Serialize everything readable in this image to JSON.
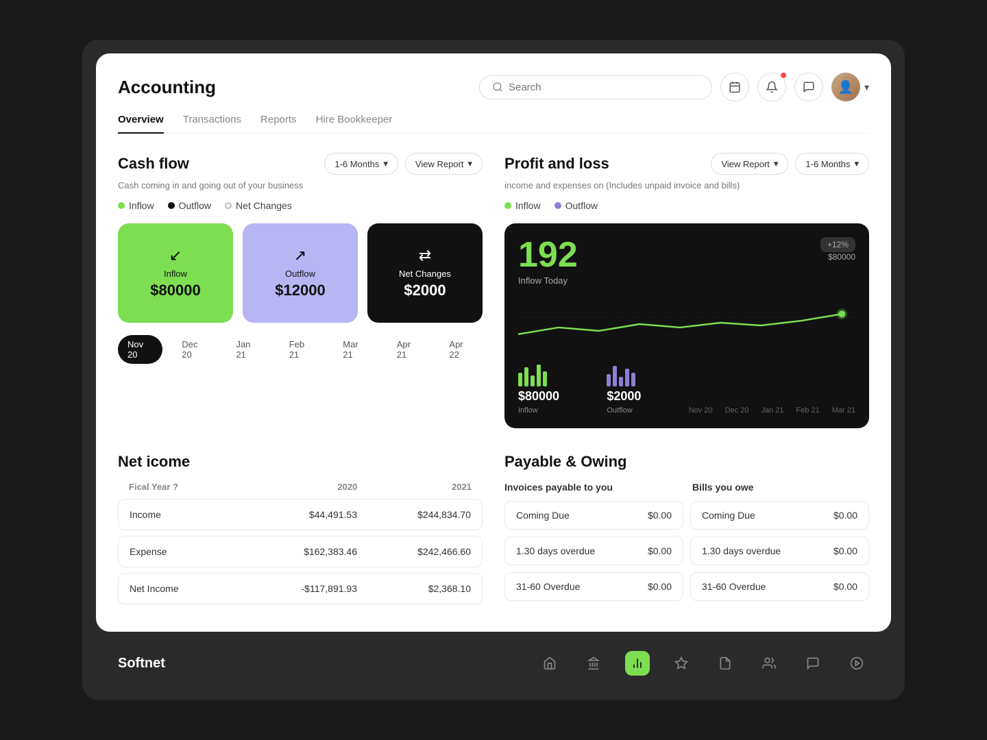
{
  "app": {
    "title": "Accounting",
    "brand": "Softnet"
  },
  "header": {
    "search_placeholder": "Search",
    "nav_tabs": [
      {
        "label": "Overview",
        "active": true
      },
      {
        "label": "Transactions",
        "active": false
      },
      {
        "label": "Reports",
        "active": false
      },
      {
        "label": "Hire Bookkeeper",
        "active": false
      }
    ]
  },
  "cashflow": {
    "title": "Cash flow",
    "subtitle": "Cash coming in and going out of your business",
    "period_label": "1-6 Months",
    "view_report_label": "View Report",
    "legend": [
      {
        "label": "Inflow",
        "type": "filled",
        "color": "#7dde52"
      },
      {
        "label": "Outflow",
        "type": "filled",
        "color": "#333"
      },
      {
        "label": "Net Changes",
        "type": "outline"
      }
    ],
    "cards": [
      {
        "label": "Inflow",
        "value": "$80000",
        "icon": "↙",
        "type": "inflow"
      },
      {
        "label": "Outflow",
        "value": "$12000",
        "icon": "↗",
        "type": "outflow"
      },
      {
        "label": "Net Changes",
        "value": "$2000",
        "icon": "→←",
        "type": "netchanges"
      }
    ],
    "timeline": [
      "Nov 20",
      "Dec 20",
      "Jan 21",
      "Feb 21",
      "Mar 21",
      "Apr 21",
      "Apr 22"
    ]
  },
  "profit_loss": {
    "title": "Profit and loss",
    "subtitle": "income and expenses on (Includes unpaid invoice and bills)",
    "view_report_label": "View Report",
    "period_label": "1-6 Months",
    "legend": [
      {
        "label": "Inflow",
        "color": "#7dde52"
      },
      {
        "label": "Outflow",
        "color": "#8b7fd4"
      }
    ],
    "chart": {
      "big_number": "192",
      "badge": "+12%",
      "label": "Inflow Today",
      "target_label": "$80000",
      "inflow_value": "$80000",
      "inflow_label": "Inflow",
      "outflow_value": "$2000",
      "outflow_label": "Outflow",
      "timeline": [
        "Nov 20",
        "Dec 20",
        "Jan 21",
        "Feb 21",
        "Mar 21"
      ]
    }
  },
  "net_income": {
    "title": "Net icome",
    "columns": [
      "Fical Year ?",
      "2020",
      "2021"
    ],
    "rows": [
      {
        "label": "Income",
        "val2020": "$44,491.53",
        "val2021": "$244,834.70"
      },
      {
        "label": "Expense",
        "val2020": "$162,383.46",
        "val2021": "$242,466.60"
      },
      {
        "label": "Net Income",
        "val2020": "-$117,891.93",
        "val2021": "$2,368.10"
      }
    ]
  },
  "payable": {
    "title": "Payable & Owing",
    "col1_title": "Invoices payable to you",
    "col2_title": "Bills you owe",
    "rows": [
      {
        "label": "Coming Due",
        "amount": "$0.00"
      },
      {
        "label": "Coming Due",
        "amount": "$0.00"
      },
      {
        "label": "1.30 days overdue",
        "amount": "$0.00"
      },
      {
        "label": "1.30 days overdue",
        "amount": "$0.00"
      },
      {
        "label": "31-60 Overdue",
        "amount": "$0.00"
      },
      {
        "label": "31-60 Overdue",
        "amount": "$0.00"
      }
    ]
  },
  "bottom_nav": {
    "icons": [
      "🏠",
      "🏦",
      "📊",
      "✨",
      "📄",
      "👥",
      "💬",
      "▶"
    ]
  }
}
